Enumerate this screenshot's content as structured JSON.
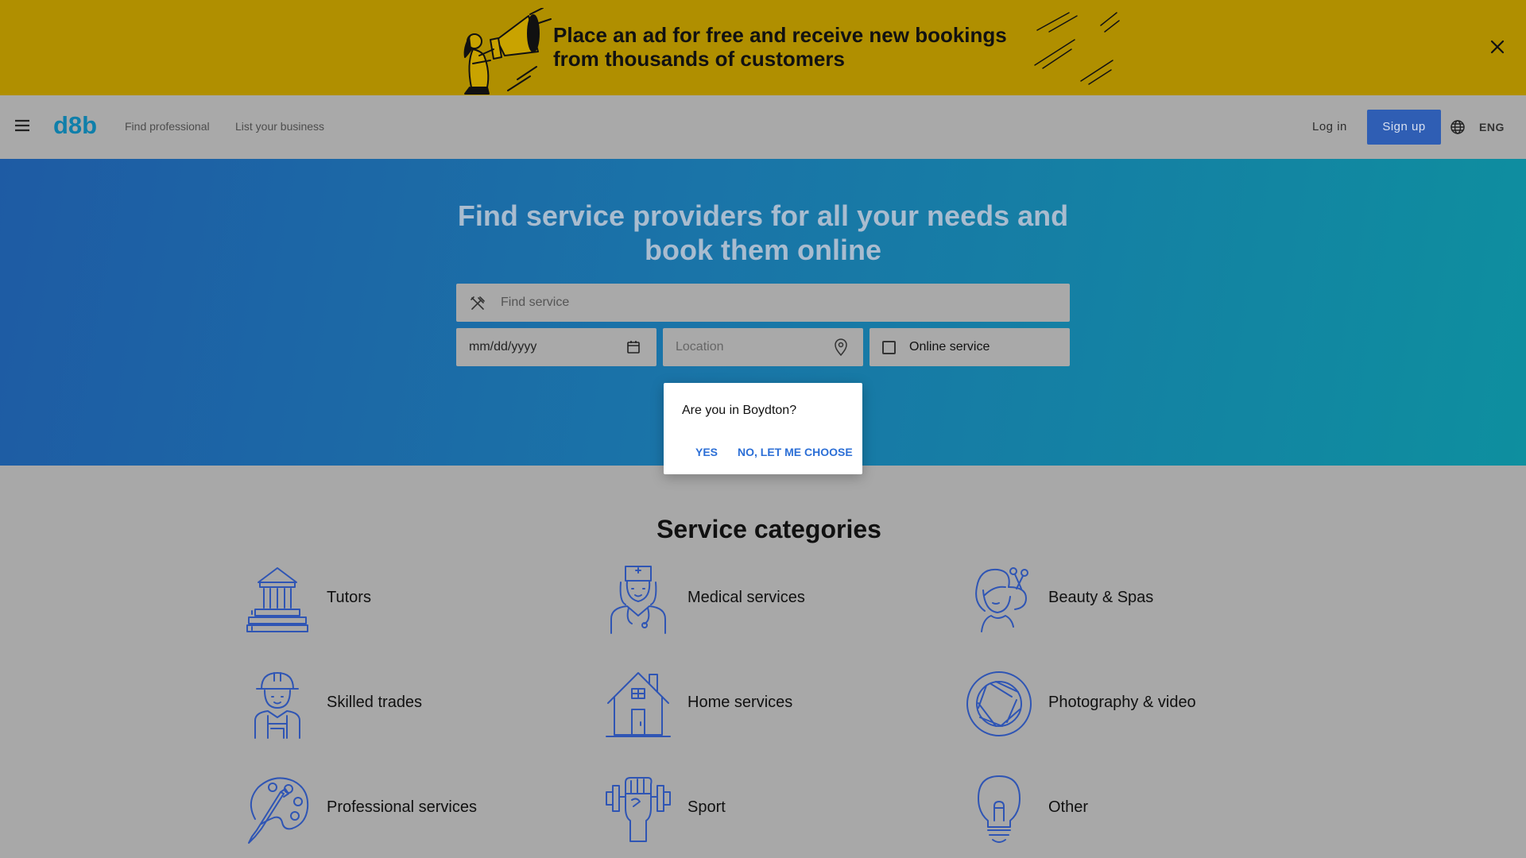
{
  "promo": {
    "text": "Place an ad for free and receive new bookings from thousands of customers"
  },
  "header": {
    "logo": "d8b",
    "nav": [
      "Find professional",
      "List your business"
    ],
    "login": "Log in",
    "signup": "Sign up",
    "language": "ENG"
  },
  "hero": {
    "title": "Find service providers for all your needs and book them online",
    "search_placeholder": "Find service",
    "date_placeholder": "mm/dd/yyyy",
    "location_placeholder": "Location",
    "online_label": "Online service"
  },
  "popup": {
    "question": "Are you in Boydton?",
    "yes": "YES",
    "no": "NO, LET ME CHOOSE"
  },
  "categories": {
    "title": "Service categories",
    "items": [
      {
        "label": "Tutors",
        "icon": "building-books-icon"
      },
      {
        "label": "Medical services",
        "icon": "nurse-icon"
      },
      {
        "label": "Beauty & Spas",
        "icon": "woman-scissors-icon"
      },
      {
        "label": "Skilled trades",
        "icon": "worker-helmet-icon"
      },
      {
        "label": "Home services",
        "icon": "house-icon"
      },
      {
        "label": "Photography & video",
        "icon": "camera-aperture-icon"
      },
      {
        "label": "Professional services",
        "icon": "palette-brush-icon"
      },
      {
        "label": "Sport",
        "icon": "dumbbell-fist-icon"
      },
      {
        "label": "Other",
        "icon": "lightbulb-icon"
      }
    ]
  },
  "colors": {
    "banner": "#b08f00",
    "accent": "#2f5eb4",
    "logo": "#0f7faa",
    "link": "#2c6fd6",
    "icon": "#2f55b4"
  }
}
